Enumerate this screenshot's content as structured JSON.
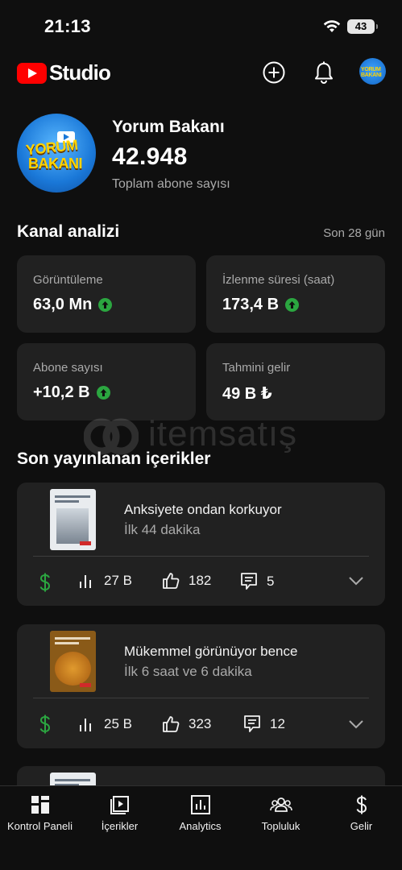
{
  "status_bar": {
    "time": "21:13",
    "battery": "43"
  },
  "header": {
    "brand": "Studio",
    "avatar_text": "YORUM BAKANI"
  },
  "channel": {
    "name": "Yorum Bakanı",
    "subscribers": "42.948",
    "subscribers_caption": "Toplam abone sayısı",
    "avatar_line1": "YORUM",
    "avatar_line2": "BAKANI"
  },
  "analytics": {
    "title": "Kanal analizi",
    "period": "Son 28 gün",
    "metrics": [
      {
        "label": "Görüntüleme",
        "value": "63,0 Mn",
        "trend": "up"
      },
      {
        "label": "İzlenme süresi (saat)",
        "value": "173,4 B",
        "trend": "up"
      },
      {
        "label": "Abone sayısı",
        "value": "+10,2 B",
        "trend": "up"
      },
      {
        "label": "Tahmini gelir",
        "value": "49 B ₺",
        "trend": "none"
      }
    ]
  },
  "recent": {
    "title": "Son yayınlanan içerikler",
    "items": [
      {
        "title": "Anksiyete ondan korkuyor",
        "subtitle": "İlk 44 dakika",
        "views": "27 B",
        "likes": "182",
        "comments": "5"
      },
      {
        "title": "Mükemmel görünüyor bence",
        "subtitle": "İlk 6 saat ve 6 dakika",
        "views": "25 B",
        "likes": "323",
        "comments": "12"
      }
    ]
  },
  "watermark": {
    "text": "itemsatış"
  },
  "nav": [
    {
      "label": "Kontrol Paneli",
      "icon": "dashboard-icon"
    },
    {
      "label": "İçerikler",
      "icon": "content-icon"
    },
    {
      "label": "Analytics",
      "icon": "analytics-icon"
    },
    {
      "label": "Topluluk",
      "icon": "community-icon"
    },
    {
      "label": "Gelir",
      "icon": "earn-icon"
    }
  ],
  "colors": {
    "background": "#0f0f0f",
    "card": "#212121",
    "accent_green": "#2ba640",
    "brand_red": "#ff0000"
  }
}
